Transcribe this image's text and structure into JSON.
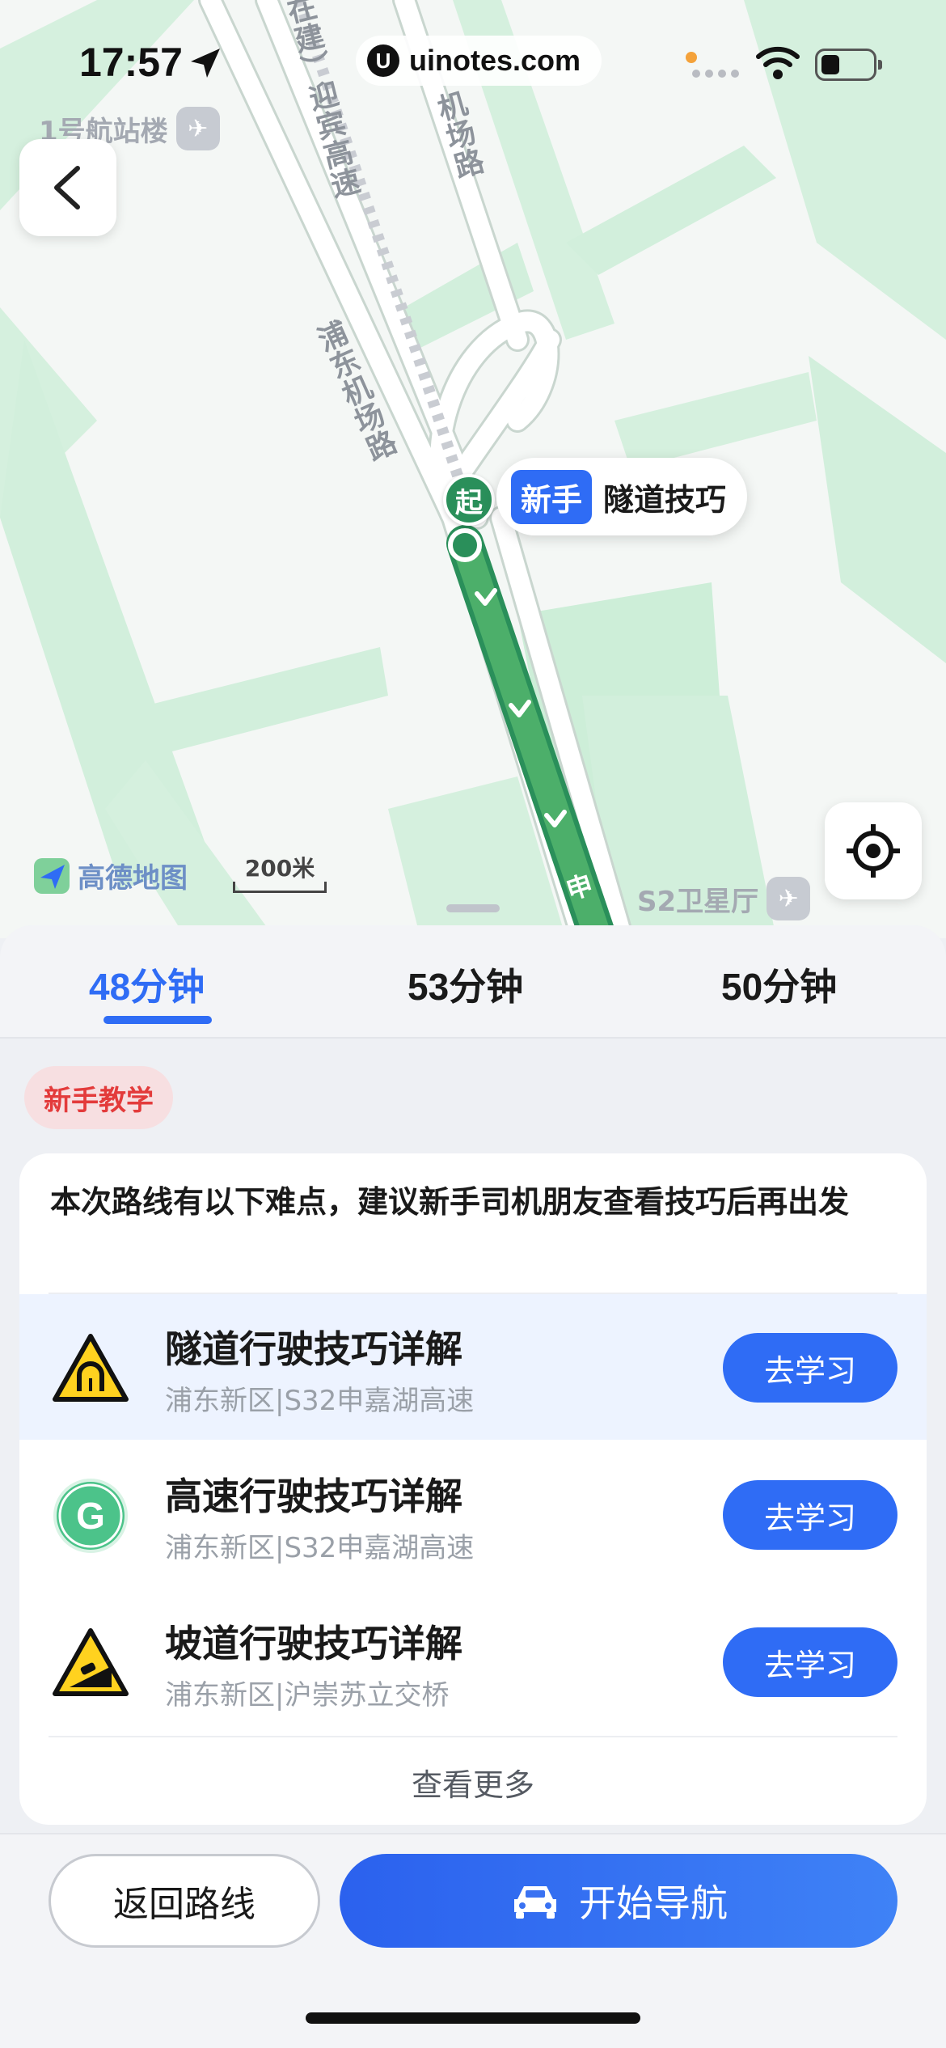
{
  "status_bar": {
    "time": "17:57",
    "url": "uinotes.com",
    "url_logo": "U"
  },
  "map": {
    "labels": {
      "road_vertical": "在建）迎宾高速",
      "road_airport": "浦东机场路",
      "road_top_right": "机场路",
      "road_bottom": "申"
    },
    "poi_terminal": {
      "name": "1号航站楼",
      "icon": "plane-icon"
    },
    "poi_satellite": {
      "name": "S2卫星厅",
      "icon": "plane-icon"
    },
    "start_marker": "起",
    "tip_bubble": {
      "tag": "新手",
      "text": "隧道技巧"
    },
    "brand": "高德地图",
    "scale": "200米",
    "colors": {
      "route": "#4caf6a",
      "route_border": "#2a8f5a",
      "green_area": "#cdeed8"
    }
  },
  "route_tabs": [
    {
      "label": "48分钟",
      "active": true
    },
    {
      "label": "53分钟",
      "active": false
    },
    {
      "label": "50分钟",
      "active": false
    }
  ],
  "novice_badge": "新手教学",
  "card": {
    "intro": "本次路线有以下难点，建议新手司机朋友查看技巧后再出发",
    "items": [
      {
        "title": "隧道行驶技巧详解",
        "subtitle": "浦东新区|S32申嘉湖高速",
        "button": "去学习",
        "icon": "tunnel-warning-icon"
      },
      {
        "title": "高速行驶技巧详解",
        "subtitle": "浦东新区|S32申嘉湖高速",
        "button": "去学习",
        "icon": "highway-g-icon",
        "icon_letter": "G"
      },
      {
        "title": "坡道行驶技巧详解",
        "subtitle": "浦东新区|沪崇苏立交桥",
        "button": "去学习",
        "icon": "slope-warning-icon"
      }
    ],
    "more": "查看更多"
  },
  "bottom": {
    "back_route": "返回路线",
    "start_nav": "开始导航"
  },
  "accent": "#2f6cf5"
}
